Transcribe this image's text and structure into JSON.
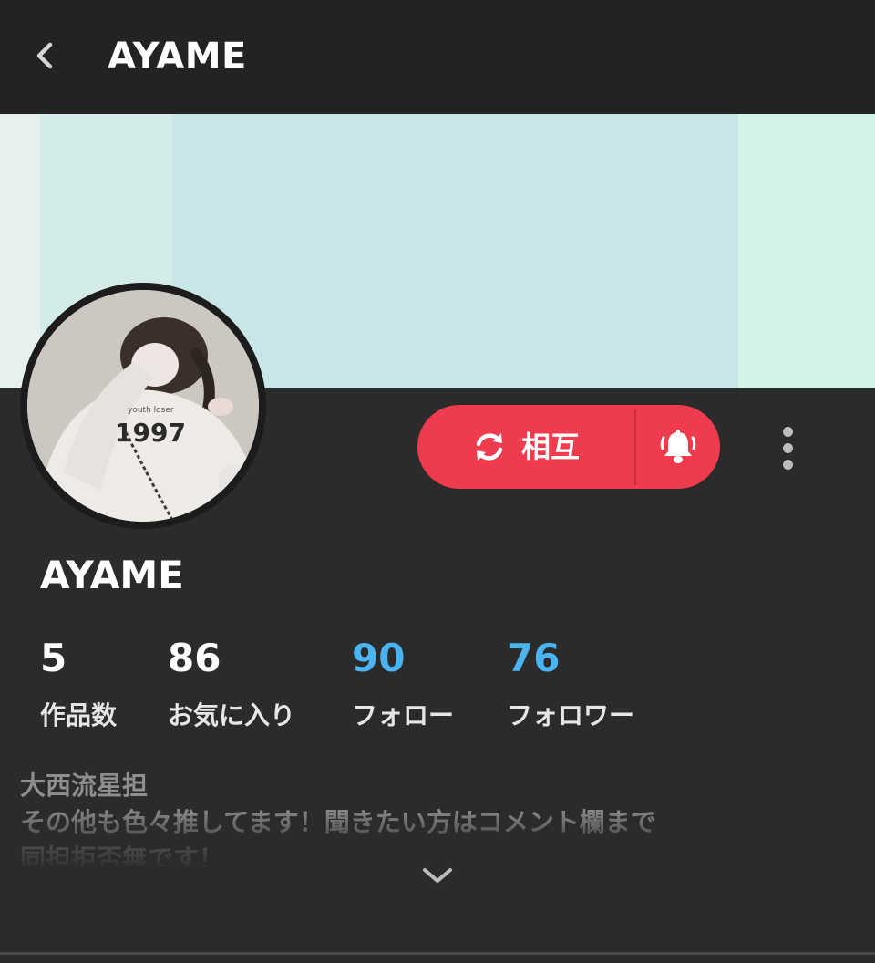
{
  "header": {
    "title": "AYAME",
    "back_icon": "chevron-left-icon"
  },
  "profile": {
    "name": "AYAME",
    "avatar_text": "1997",
    "avatar_small_text": "youth loser"
  },
  "actions": {
    "mutual_label": "相互",
    "mutual_icon": "refresh-icon",
    "bell_icon": "bell-icon",
    "more_icon": "more-vertical-icon",
    "accent_color": "#ee3b4e"
  },
  "stats": [
    {
      "value": "5",
      "label": "作品数"
    },
    {
      "value": "86",
      "label": "お気に入り"
    },
    {
      "value": "90",
      "label": "フォロー"
    },
    {
      "value": "76",
      "label": "フォロワー"
    }
  ],
  "bio": {
    "lines": [
      "大西流星担",
      "その他も色々推してます！聞きたい方はコメント欄まで",
      "同担拒否無です！"
    ],
    "expand_icon": "chevron-down-icon"
  },
  "colors": {
    "background": "#2b2b2b",
    "header": "#232323",
    "stat_highlight": "#4ab4f0"
  }
}
